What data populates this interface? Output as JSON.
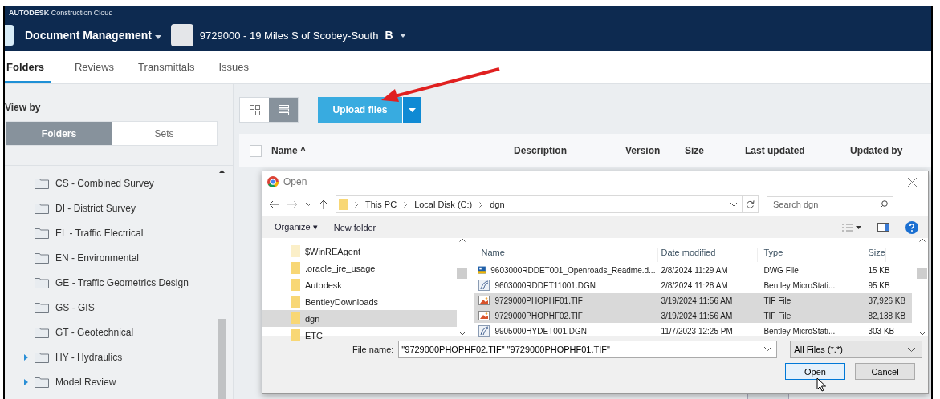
{
  "header": {
    "brand_strong": "AUTODESK",
    "brand_rest": "Construction Cloud",
    "module": "Document Management",
    "project": "9729000 - 19 Miles S of Scobey-South",
    "project_badge": "B"
  },
  "tabs": [
    {
      "label": "Folders",
      "selected": true
    },
    {
      "label": "Reviews",
      "selected": false
    },
    {
      "label": "Transmittals",
      "selected": false
    },
    {
      "label": "Issues",
      "selected": false
    }
  ],
  "sidebar": {
    "view_by": "View by",
    "segments": [
      {
        "label": "Folders",
        "selected": true
      },
      {
        "label": "Sets",
        "selected": false
      }
    ],
    "folders": [
      {
        "label": "CS - Combined Survey",
        "expandable": false
      },
      {
        "label": "DI - District Survey",
        "expandable": false
      },
      {
        "label": "EL - Traffic Electrical",
        "expandable": false
      },
      {
        "label": "EN - Environmental",
        "expandable": false
      },
      {
        "label": "GE - Traffic Geometrics Design",
        "expandable": false
      },
      {
        "label": "GS - GIS",
        "expandable": false
      },
      {
        "label": "GT - Geotechnical",
        "expandable": false
      },
      {
        "label": "HY - Hydraulics",
        "expandable": true
      },
      {
        "label": "Model Review",
        "expandable": true
      }
    ]
  },
  "toolbar": {
    "view_modes": [
      {
        "kind": "grid",
        "selected": false
      },
      {
        "kind": "list",
        "selected": true
      }
    ],
    "upload_label": "Upload files"
  },
  "table": {
    "select_all_checked": false,
    "columns": [
      "Name ^",
      "Description",
      "Version",
      "Size",
      "Last updated",
      "Updated by"
    ]
  },
  "dialog": {
    "title": "Open",
    "path": [
      "This PC",
      "Local Disk (C:)",
      "dgn"
    ],
    "search_placeholder": "Search dgn",
    "organize": "Organize ▾",
    "new_folder": "New folder",
    "nav": [
      {
        "label": "$WinREAgent",
        "hidden": true,
        "selected": false
      },
      {
        "label": ".oracle_jre_usage",
        "hidden": false,
        "selected": false
      },
      {
        "label": "Autodesk",
        "hidden": false,
        "selected": false
      },
      {
        "label": "BentleyDownloads",
        "hidden": false,
        "selected": false
      },
      {
        "label": "dgn",
        "hidden": false,
        "selected": true
      },
      {
        "label": "ETC",
        "hidden": false,
        "selected": false
      }
    ],
    "columns": [
      "Name",
      "Date modified",
      "Type",
      "Size"
    ],
    "files": [
      {
        "kind": "dwg",
        "name": "9603000RDDET001_Openroads_Readme.d...",
        "date": "2/8/2024 11:29 AM",
        "type": "DWG File",
        "size": "15 KB",
        "selected": false
      },
      {
        "kind": "dgn",
        "name": "9603000RDDET11001.DGN",
        "date": "2/8/2024 11:28 AM",
        "type": "Bentley MicroStati...",
        "size": "95 KB",
        "selected": false
      },
      {
        "kind": "tif",
        "name": "9729000PHOPHF01.TIF",
        "date": "3/19/2024 11:56 AM",
        "type": "TIF File",
        "size": "37,926 KB",
        "selected": true
      },
      {
        "kind": "tif",
        "name": "9729000PHOPHF02.TIF",
        "date": "3/19/2024 11:56 AM",
        "type": "TIF File",
        "size": "82,138 KB",
        "selected": true
      },
      {
        "kind": "dgn",
        "name": "9905000HYDET001.DGN",
        "date": "11/7/2023 12:25 PM",
        "type": "Bentley MicroStati...",
        "size": "303 KB",
        "selected": false
      }
    ],
    "file_name_label": "File name:",
    "file_name": "\"9729000PHOPHF02.TIF\" \"9729000PHOPHF01.TIF\"",
    "filter": "All Files (*.*)",
    "open_label": "Open",
    "cancel_label": "Cancel"
  }
}
